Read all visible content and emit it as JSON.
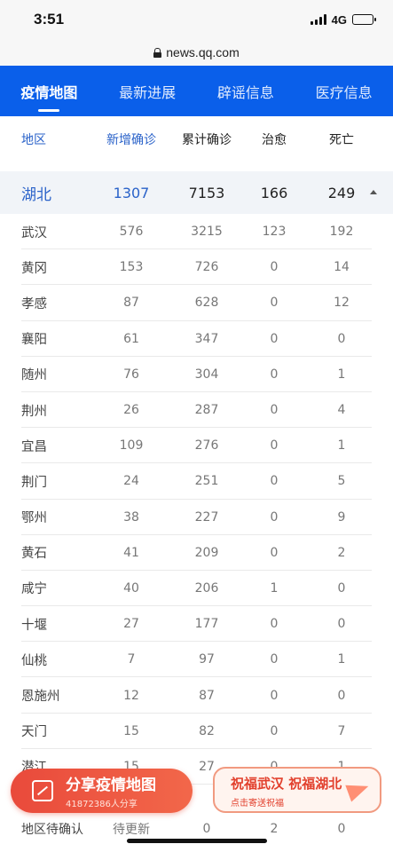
{
  "status": {
    "time": "3:51",
    "network": "4G"
  },
  "url": "news.qq.com",
  "tabs": [
    {
      "label": "疫情地图"
    },
    {
      "label": "最新进展"
    },
    {
      "label": "辟谣信息"
    },
    {
      "label": "医疗信息"
    }
  ],
  "table": {
    "headers": [
      "地区",
      "新增确诊",
      "累计确诊",
      "治愈",
      "死亡"
    ],
    "province": {
      "name": "湖北",
      "new": "1307",
      "total": "7153",
      "cured": "166",
      "dead": "249"
    },
    "rows": [
      [
        "武汉",
        "576",
        "3215",
        "123",
        "192"
      ],
      [
        "黄冈",
        "153",
        "726",
        "0",
        "14"
      ],
      [
        "孝感",
        "87",
        "628",
        "0",
        "12"
      ],
      [
        "襄阳",
        "61",
        "347",
        "0",
        "0"
      ],
      [
        "随州",
        "76",
        "304",
        "0",
        "1"
      ],
      [
        "荆州",
        "26",
        "287",
        "0",
        "4"
      ],
      [
        "宜昌",
        "109",
        "276",
        "0",
        "1"
      ],
      [
        "荆门",
        "24",
        "251",
        "0",
        "5"
      ],
      [
        "鄂州",
        "38",
        "227",
        "0",
        "9"
      ],
      [
        "黄石",
        "41",
        "209",
        "0",
        "2"
      ],
      [
        "咸宁",
        "40",
        "206",
        "1",
        "0"
      ],
      [
        "十堰",
        "27",
        "177",
        "0",
        "0"
      ],
      [
        "仙桃",
        "7",
        "97",
        "0",
        "1"
      ],
      [
        "恩施州",
        "12",
        "87",
        "0",
        "0"
      ],
      [
        "天门",
        "15",
        "82",
        "0",
        "7"
      ],
      [
        "潜江",
        "15",
        "27",
        "0",
        "1"
      ]
    ],
    "last_row": [
      "地区待确认",
      "待更新",
      "0",
      "2",
      "0"
    ]
  },
  "share": {
    "label": "分享疫情地图",
    "count": "41872386人分享"
  },
  "bless": {
    "label": "祝福武汉 祝福湖北",
    "sub": "点击寄送祝福"
  },
  "colors": {
    "brand_blue": "#0a5fea",
    "accent_red": "#e94a3b"
  }
}
